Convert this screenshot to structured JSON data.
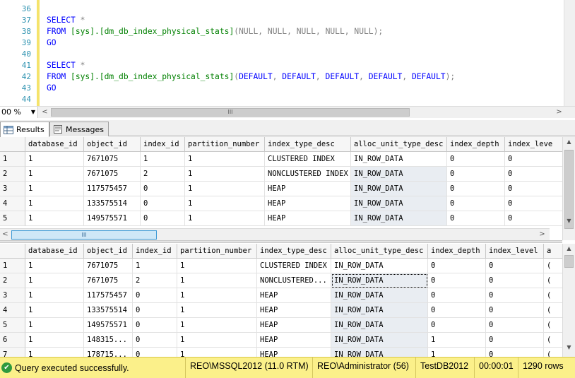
{
  "editor": {
    "lines": [
      {
        "num": "36",
        "tokens": []
      },
      {
        "num": "37",
        "tokens": [
          {
            "t": "SELECT",
            "c": "kw"
          },
          {
            "t": " *",
            "c": "pl"
          }
        ]
      },
      {
        "num": "38",
        "tokens": [
          {
            "t": "FROM",
            "c": "kw"
          },
          {
            "t": " [sys].[dm_db_index_physical_stats]",
            "c": "fn"
          },
          {
            "t": "(",
            "c": "pl"
          },
          {
            "t": "NULL",
            "c": "pl"
          },
          {
            "t": ", ",
            "c": "pl"
          },
          {
            "t": "NULL",
            "c": "pl"
          },
          {
            "t": ", ",
            "c": "pl"
          },
          {
            "t": "NULL",
            "c": "pl"
          },
          {
            "t": ", ",
            "c": "pl"
          },
          {
            "t": "NULL",
            "c": "pl"
          },
          {
            "t": ", ",
            "c": "pl"
          },
          {
            "t": "NULL",
            "c": "pl"
          },
          {
            "t": ");",
            "c": "pl"
          }
        ]
      },
      {
        "num": "39",
        "tokens": [
          {
            "t": "GO",
            "c": "kw"
          }
        ]
      },
      {
        "num": "40",
        "tokens": []
      },
      {
        "num": "41",
        "tokens": [
          {
            "t": "SELECT",
            "c": "kw"
          },
          {
            "t": " *",
            "c": "pl"
          }
        ]
      },
      {
        "num": "42",
        "tokens": [
          {
            "t": "FROM",
            "c": "kw"
          },
          {
            "t": " [sys].[dm_db_index_physical_stats]",
            "c": "fn"
          },
          {
            "t": "(",
            "c": "pl"
          },
          {
            "t": "DEFAULT",
            "c": "kw"
          },
          {
            "t": ", ",
            "c": "pl"
          },
          {
            "t": "DEFAULT",
            "c": "kw"
          },
          {
            "t": ", ",
            "c": "pl"
          },
          {
            "t": "DEFAULT",
            "c": "kw"
          },
          {
            "t": ", ",
            "c": "pl"
          },
          {
            "t": "DEFAULT",
            "c": "kw"
          },
          {
            "t": ", ",
            "c": "pl"
          },
          {
            "t": "DEFAULT",
            "c": "kw"
          },
          {
            "t": ");",
            "c": "pl"
          }
        ]
      },
      {
        "num": "43",
        "tokens": [
          {
            "t": "GO",
            "c": "kw"
          }
        ]
      },
      {
        "num": "44",
        "tokens": []
      }
    ],
    "zoom": "00 %",
    "scroll_left": "<",
    "scroll_right": ">",
    "thumb_grip": "III"
  },
  "tabs": [
    {
      "label": "Results",
      "icon": "grid-icon",
      "active": true
    },
    {
      "label": "Messages",
      "icon": "messages-icon",
      "active": false
    }
  ],
  "grid1": {
    "columns": [
      "database_id",
      "object_id",
      "index_id",
      "partition_number",
      "index_type_desc",
      "alloc_unit_type_desc",
      "index_depth",
      "index_leve"
    ],
    "rows": [
      {
        "n": "1",
        "cells": [
          "1",
          "7671075",
          "1",
          "1",
          "CLUSTERED INDEX",
          "IN_ROW_DATA",
          "0",
          "0"
        ]
      },
      {
        "n": "2",
        "cells": [
          "1",
          "7671075",
          "2",
          "1",
          "NONCLUSTERED INDEX",
          "IN_ROW_DATA",
          "0",
          "0"
        ]
      },
      {
        "n": "3",
        "cells": [
          "1",
          "117575457",
          "0",
          "1",
          "HEAP",
          "IN_ROW_DATA",
          "0",
          "0"
        ]
      },
      {
        "n": "4",
        "cells": [
          "1",
          "133575514",
          "0",
          "1",
          "HEAP",
          "IN_ROW_DATA",
          "0",
          "0"
        ]
      },
      {
        "n": "5",
        "cells": [
          "1",
          "149575571",
          "0",
          "1",
          "HEAP",
          "IN_ROW_DATA",
          "0",
          "0"
        ]
      }
    ],
    "scroll_left": "<",
    "scroll_right": ">",
    "thumb_grip": "III"
  },
  "grid2": {
    "columns": [
      "database_id",
      "object_id",
      "index_id",
      "partition_number",
      "index_type_desc",
      "alloc_unit_type_desc",
      "index_depth",
      "index_level",
      "a"
    ],
    "rows": [
      {
        "n": "1",
        "cells": [
          "1",
          "7671075",
          "1",
          "1",
          "CLUSTERED INDEX",
          "IN_ROW_DATA",
          "0",
          "0",
          "("
        ]
      },
      {
        "n": "2",
        "cells": [
          "1",
          "7671075",
          "2",
          "1",
          "NONCLUSTERED...",
          "IN_ROW_DATA",
          "0",
          "0",
          "("
        ]
      },
      {
        "n": "3",
        "cells": [
          "1",
          "117575457",
          "0",
          "1",
          "HEAP",
          "IN_ROW_DATA",
          "0",
          "0",
          "("
        ]
      },
      {
        "n": "4",
        "cells": [
          "1",
          "133575514",
          "0",
          "1",
          "HEAP",
          "IN_ROW_DATA",
          "0",
          "0",
          "("
        ]
      },
      {
        "n": "5",
        "cells": [
          "1",
          "149575571",
          "0",
          "1",
          "HEAP",
          "IN_ROW_DATA",
          "0",
          "0",
          "("
        ]
      },
      {
        "n": "6",
        "cells": [
          "1",
          "148315...",
          "0",
          "1",
          "HEAP",
          "IN_ROW_DATA",
          "1",
          "0",
          "("
        ]
      },
      {
        "n": "7",
        "cells": [
          "1",
          "178715...",
          "0",
          "1",
          "HEAP",
          "IN_ROW_DATA",
          "1",
          "0",
          "("
        ]
      }
    ]
  },
  "status": {
    "message": "Query executed successfully.",
    "server": "REO\\MSSQL2012 (11.0 RTM)",
    "user": "REO\\Administrator (56)",
    "database": "TestDB2012",
    "elapsed": "00:00:01",
    "rows": "1290 rows"
  },
  "colors": {
    "keyword": "#0000ff",
    "function": "#008000",
    "punct": "#808080",
    "line_number": "#2b91af",
    "status_bar": "#fbf08a",
    "success": "#2e9a3d"
  }
}
